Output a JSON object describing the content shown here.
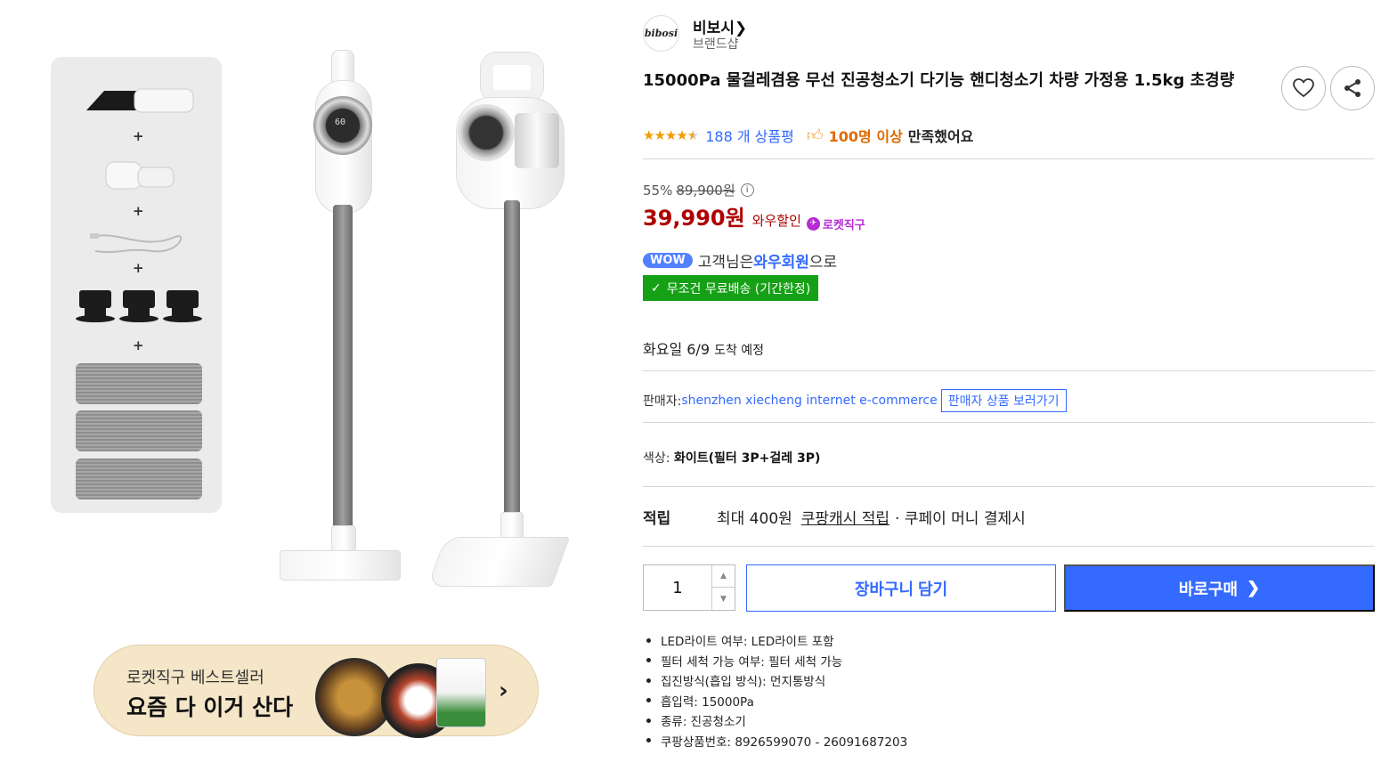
{
  "brand": {
    "logo_text": "bibosi",
    "name": "비보시",
    "sub": "브랜드샵"
  },
  "product": {
    "title": "15000Pa 물걸레겸용 무선 진공청소기 다기능 핸디청소기 차량 가정용 1.5kg 초경량"
  },
  "rating": {
    "stars": 4.5,
    "review_count_text": "188 개 상품평",
    "satisfied_count": "100명 이상",
    "satisfied_text": "만족했어요"
  },
  "price": {
    "discount_rate": "55%",
    "original_price": "89,900원",
    "sale_price": "39,990원",
    "wow_discount_label": "와우할인",
    "rocket_label": "로켓직구"
  },
  "wow": {
    "badge": "WOW",
    "text_before": "고객님은",
    "member_label": "와우회원",
    "text_after": "으로",
    "free_shipping": "무조건 무료배송 (기간한정)"
  },
  "delivery": {
    "day": "화요일 6/9",
    "suffix": "도착 예정"
  },
  "seller": {
    "label": "판매자:",
    "name": "shenzhen xiecheng internet e-commerce",
    "link_label": "판매자 상품 보러가기"
  },
  "option": {
    "label": "색상:",
    "value": "화이트(필터 3P+걸레 3P)"
  },
  "points": {
    "label": "적립",
    "text_before": "최대 400원",
    "link": "쿠팡캐시 적립",
    "text_after": "· 쿠페이 머니 결제시"
  },
  "purchase": {
    "quantity": "1",
    "cart_label": "장바구니 담기",
    "buy_label": "바로구매"
  },
  "specs": [
    "LED라이트 여부: LED라이트 포함",
    "필터 세척 가능 여부: 필터 세척 가능",
    "집진방식(흡입 방식): 먼지통방식",
    "흡입력: 15000Pa",
    "종류: 진공청소기",
    "쿠팡상품번호: 8926599070 - 26091687203"
  ],
  "promo": {
    "line1": "로켓직구 베스트셀러",
    "line2": "요즘 다 이거 산다"
  },
  "colors": {
    "accent_blue": "#346aff",
    "price_red": "#ae0000",
    "free_ship_green": "#16a016",
    "rocket_purple": "#b52bd4"
  }
}
